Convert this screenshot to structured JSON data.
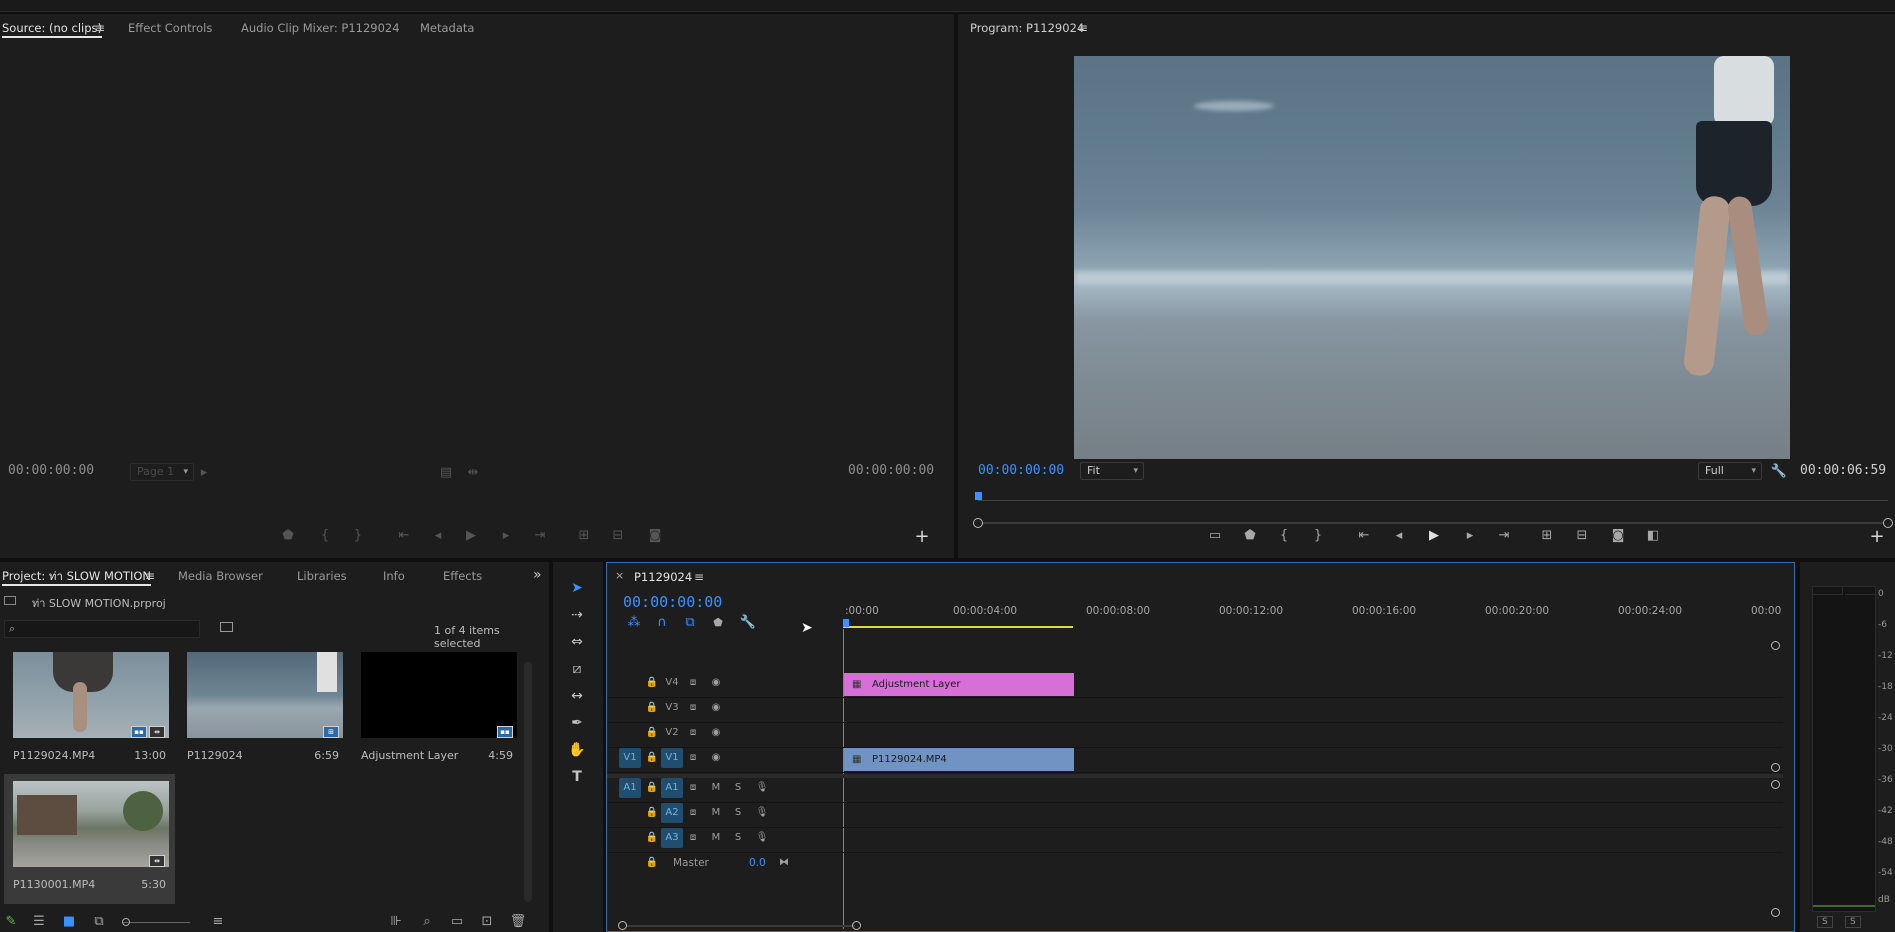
{
  "source_panel": {
    "tabs": [
      "Source: (no clips)",
      "Effect Controls",
      "Audio Clip Mixer: P1129024",
      "Metadata"
    ],
    "timecode_left": "00:00:00:00",
    "page_label": "Page 1",
    "timecode_right": "00:00:00:00"
  },
  "program_panel": {
    "title": "Program: P1129024",
    "timecode_current": "00:00:00:00",
    "zoom": "Fit",
    "resolution": "Full",
    "timecode_duration": "00:00:06:59"
  },
  "project_panel": {
    "tabs": [
      "Project: ท่า SLOW MOTION",
      "Media Browser",
      "Libraries",
      "Info",
      "Effects"
    ],
    "project_file": "ท่า SLOW MOTION.prproj",
    "search_placeholder": "",
    "selection_status": "1 of 4 items selected",
    "items": [
      {
        "name": "P1129024.MP4",
        "duration": "13:00"
      },
      {
        "name": "P1129024",
        "duration": "6:59"
      },
      {
        "name": "Adjustment Layer",
        "duration": "4:59"
      },
      {
        "name": "P1130001.MP4",
        "duration": "5:30"
      }
    ]
  },
  "timeline_panel": {
    "sequence_tab": "P1129024",
    "timecode": "00:00:00:00",
    "ruler_labels": [
      ":00:00",
      "00:00:04:00",
      "00:00:08:00",
      "00:00:12:00",
      "00:00:16:00",
      "00:00:20:00",
      "00:00:24:00",
      "00:00"
    ],
    "video_tracks": [
      "V4",
      "V3",
      "V2",
      "V1"
    ],
    "audio_tracks": [
      "A1",
      "A2",
      "A3"
    ],
    "source_patch_video": "V1",
    "source_patch_audio": "A1",
    "mute_label": "M",
    "solo_label": "S",
    "master_label": "Master",
    "master_value": "0.0",
    "clips": {
      "adjustment": "Adjustment Layer",
      "video": "P1129024.MP4"
    }
  },
  "audio_meter": {
    "scale": [
      "0",
      "-6",
      "-12",
      "-18",
      "-24",
      "-30",
      "-36",
      "-42",
      "-48",
      "-54",
      "dB"
    ],
    "solo_labels": [
      "S",
      "S"
    ]
  },
  "colors": {
    "accent": "#3b91ff",
    "adjustment_clip": "#d66fd6",
    "video_clip": "#6f93c3",
    "track_active": "#214d6e"
  }
}
